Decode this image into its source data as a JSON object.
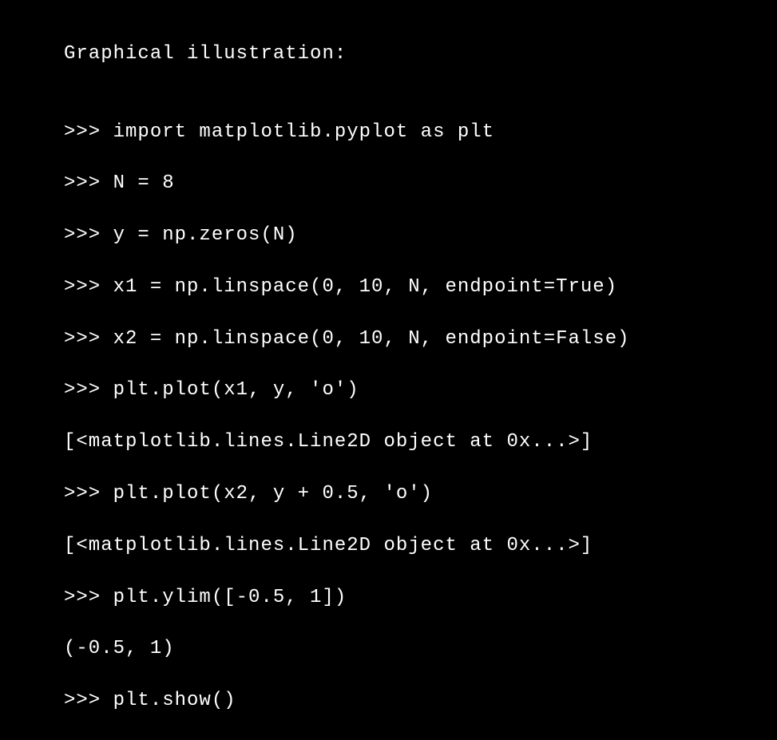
{
  "terminal": {
    "lines": [
      "Graphical illustration:",
      "",
      ">>> import matplotlib.pyplot as plt",
      ">>> N = 8",
      ">>> y = np.zeros(N)",
      ">>> x1 = np.linspace(0, 10, N, endpoint=True)",
      ">>> x2 = np.linspace(0, 10, N, endpoint=False)",
      ">>> plt.plot(x1, y, 'o')",
      "[<matplotlib.lines.Line2D object at 0x...>]",
      ">>> plt.plot(x2, y + 0.5, 'o')",
      "[<matplotlib.lines.Line2D object at 0x...>]",
      ">>> plt.ylim([-0.5, 1])",
      "(-0.5, 1)",
      ">>> plt.show()"
    ]
  }
}
